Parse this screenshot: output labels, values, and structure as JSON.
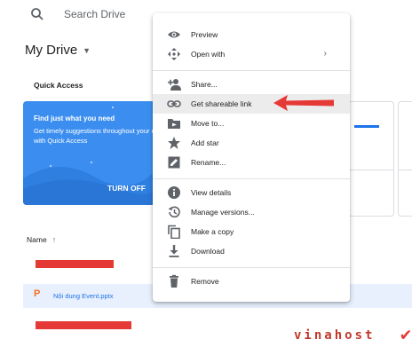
{
  "search": {
    "placeholder": "Search Drive"
  },
  "drive": {
    "title": "My Drive"
  },
  "quick_access": {
    "label": "Quick Access",
    "card_heading": "Find just what you need",
    "card_text": "Get timely suggestions throughout your day with Quick Access",
    "card_button": "TURN OFF"
  },
  "file_list": {
    "name_header": "Name",
    "rows": [
      {
        "name": "Nội dung Event.pptx",
        "type_letter": "P"
      }
    ]
  },
  "context_menu": {
    "items": [
      {
        "label": "Preview",
        "icon": "eye-icon"
      },
      {
        "label": "Open with",
        "icon": "move-arrows-icon",
        "submenu": "›"
      },
      {
        "label": "Share...",
        "icon": "add-person-icon"
      },
      {
        "label": "Get shareable link",
        "icon": "link-icon",
        "highlighted": true
      },
      {
        "label": "Move to...",
        "icon": "folder-move-icon"
      },
      {
        "label": "Add star",
        "icon": "star-icon"
      },
      {
        "label": "Rename...",
        "icon": "rename-icon"
      },
      {
        "label": "View details",
        "icon": "info-icon"
      },
      {
        "label": "Manage versions...",
        "icon": "history-icon"
      },
      {
        "label": "Make a copy",
        "icon": "copy-icon"
      },
      {
        "label": "Download",
        "icon": "download-icon"
      },
      {
        "label": "Remove",
        "icon": "trash-icon"
      }
    ]
  },
  "watermark": {
    "text": "vinahost",
    "logo": "checkmark-logo"
  },
  "colors": {
    "accent": "#1a73e8",
    "card": "#3b8ef0",
    "annotation": "#e53935"
  }
}
